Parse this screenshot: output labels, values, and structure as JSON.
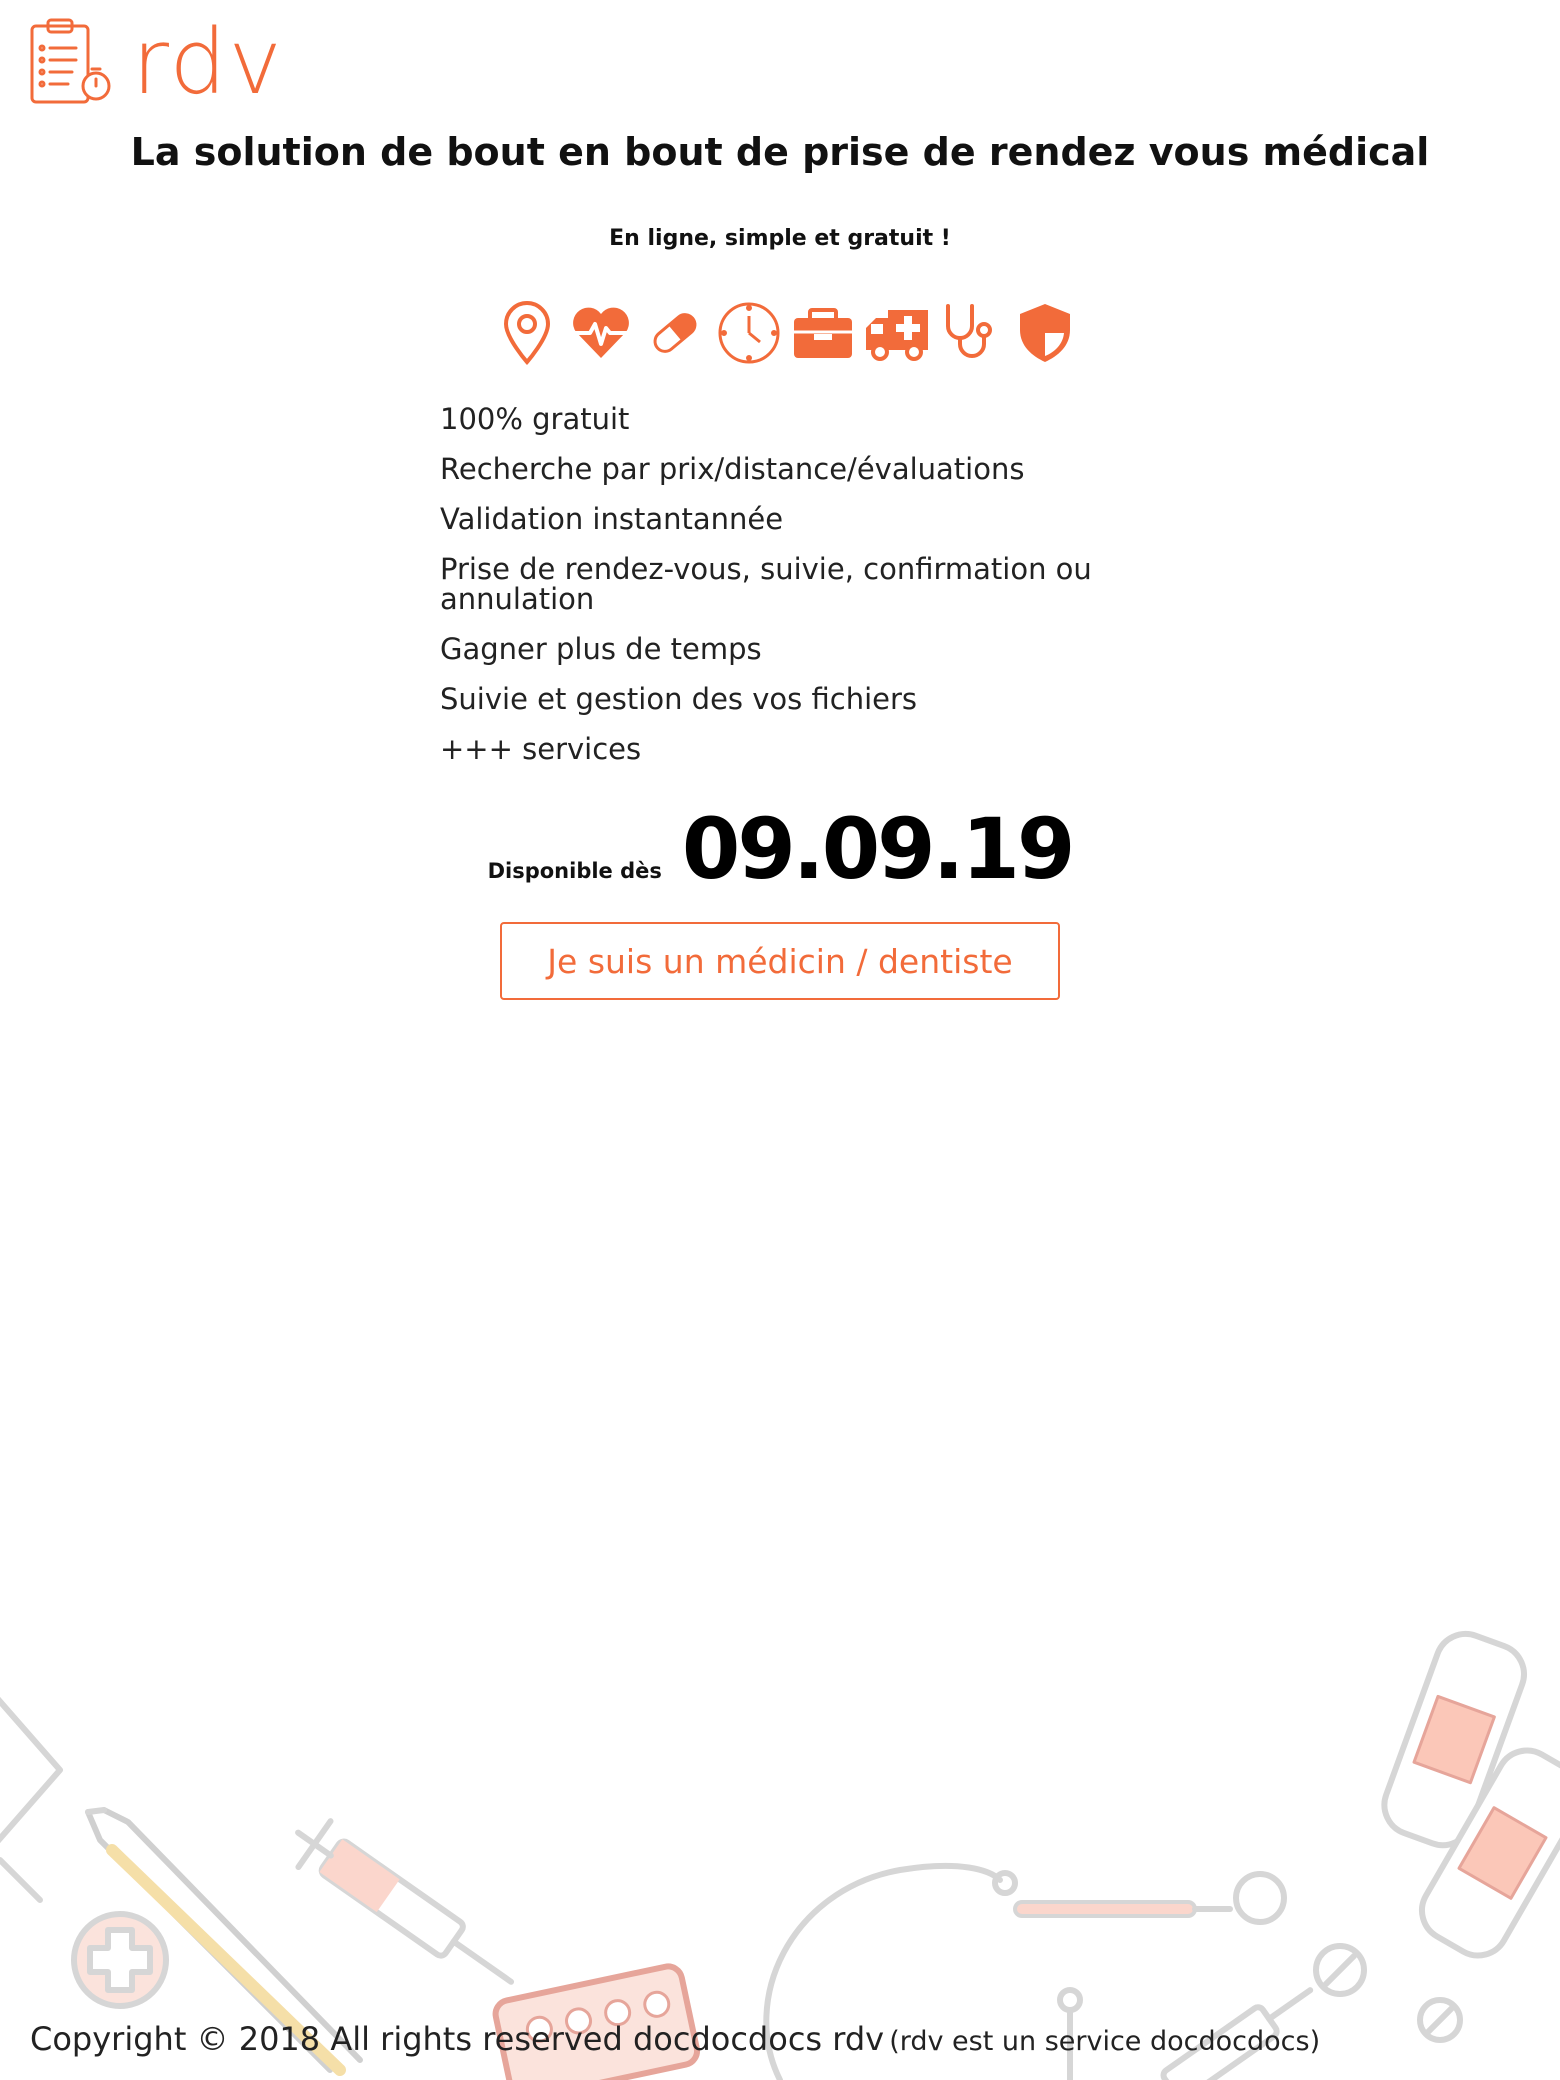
{
  "brand": {
    "name": "rdv",
    "color": "#f26b3a",
    "logo_icon": "clipboard-timer-icon"
  },
  "hero": {
    "title": "La solution de bout en bout de prise de rendez vous médical",
    "subtitle": "En ligne, simple et gratuit !"
  },
  "icons": [
    "location-pin-icon",
    "heartbeat-icon",
    "pill-icon",
    "clock-icon",
    "medical-box-icon",
    "ambulance-icon",
    "stethoscope-icon",
    "shield-icon"
  ],
  "features": [
    "100% gratuit",
    "Recherche par prix/distance/évaluations",
    "Validation instantannée",
    "Prise de rendez-vous, suivie, confirmation ou annulation",
    "Gagner plus de temps",
    "Suivie et gestion des vos fichiers",
    "+++ services"
  ],
  "availability": {
    "label": "Disponible dès",
    "date": "09.09.19"
  },
  "cta": {
    "label": "Je suis un médicin / dentiste"
  },
  "footer": {
    "copyright": "Copyright © 2018 All rights reserved docdocdocs rdv",
    "note": "(rdv est un service docdocdocs)"
  }
}
